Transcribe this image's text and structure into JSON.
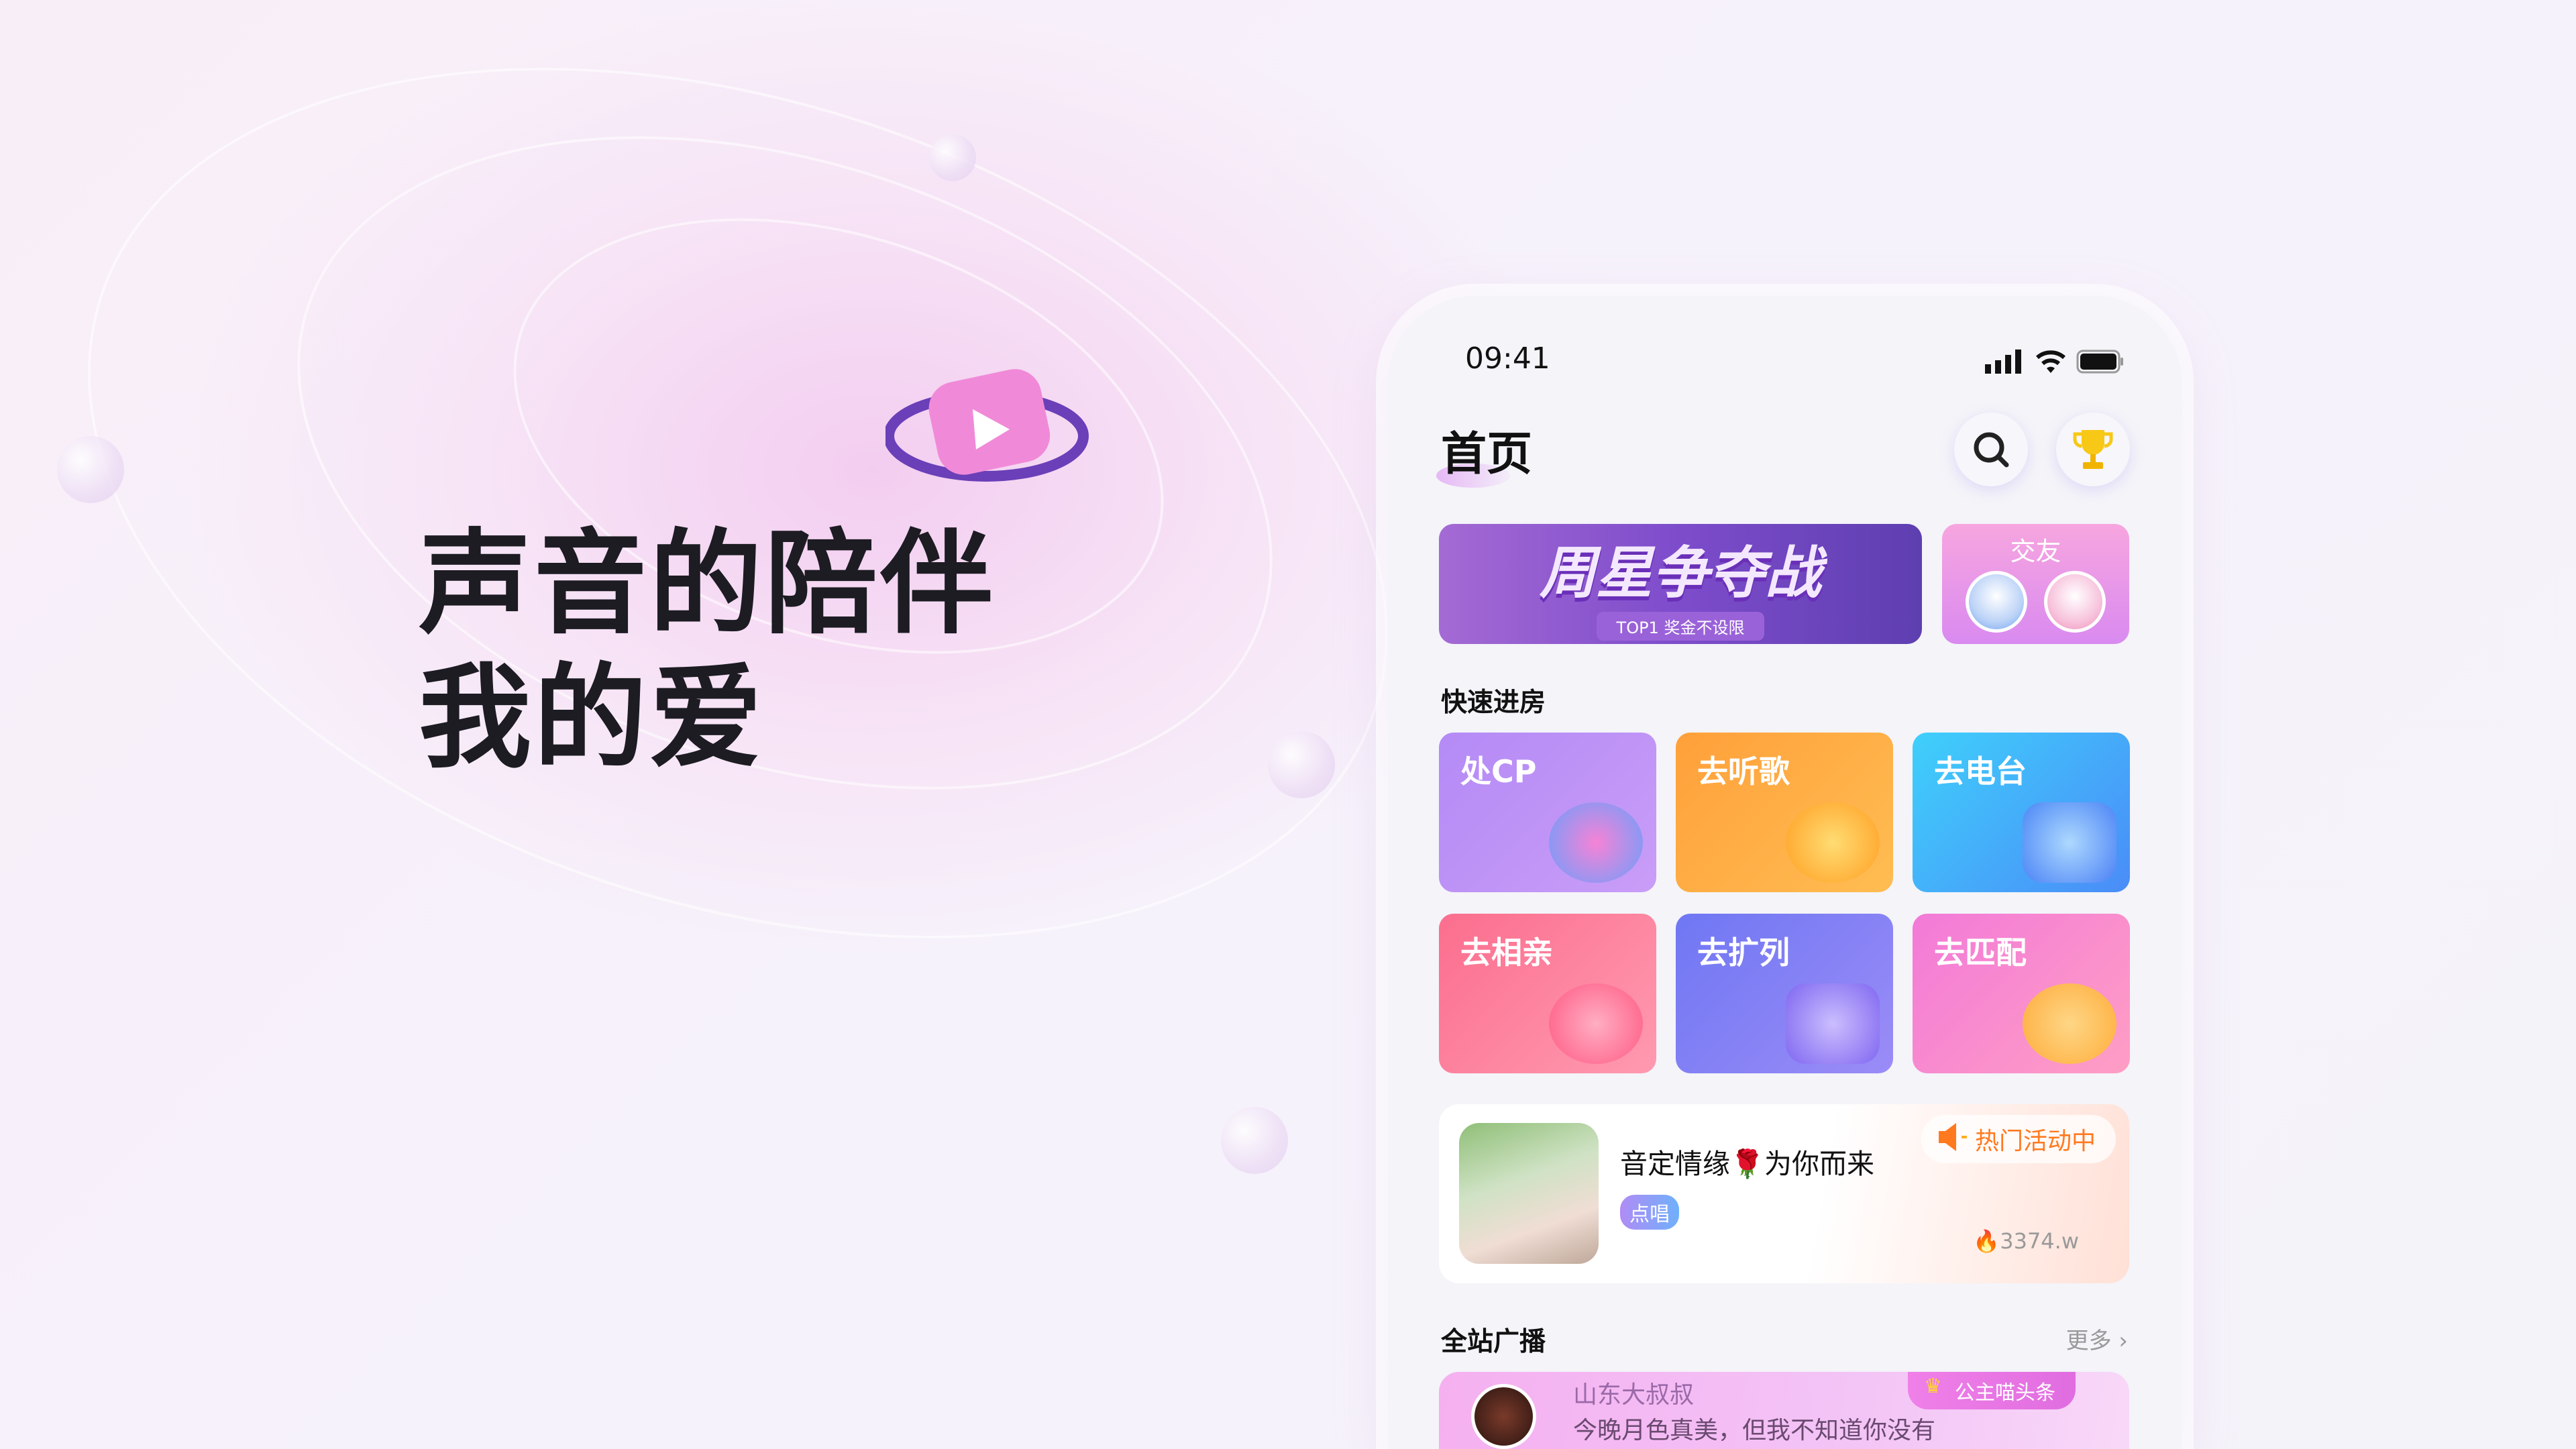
{
  "hero": {
    "line1": "声音的陪伴",
    "line2": "我的爱"
  },
  "status_bar": {
    "time": "09:41"
  },
  "header": {
    "title": "首页",
    "search_icon": "search-icon",
    "trophy_icon": "trophy-icon"
  },
  "banners": {
    "main_title": "周星争夺战",
    "main_subtitle": "TOP1 奖金不设限",
    "side_label": "交友"
  },
  "quick": {
    "title": "快速进房",
    "tiles": [
      {
        "label": "处CP",
        "color": "#b48af6"
      },
      {
        "label": "去听歌",
        "color": "#ffa53c"
      },
      {
        "label": "去电台",
        "color": "#3fb2fb"
      },
      {
        "label": "去相亲",
        "color": "#fb7393"
      },
      {
        "label": "去扩列",
        "color": "#7c79f3"
      },
      {
        "label": "去匹配",
        "color": "#f47fd9"
      }
    ]
  },
  "activity": {
    "name": "音定情缘🌹为你而来",
    "badge": "点唱",
    "hot_label": "热门活动中",
    "heat": "3374.w"
  },
  "broadcast": {
    "title": "全站广播",
    "more": "更多",
    "user": "山东大叔叔",
    "message": "今晚月色真美，但我不知道你没有",
    "tag": "公主喵头条"
  }
}
